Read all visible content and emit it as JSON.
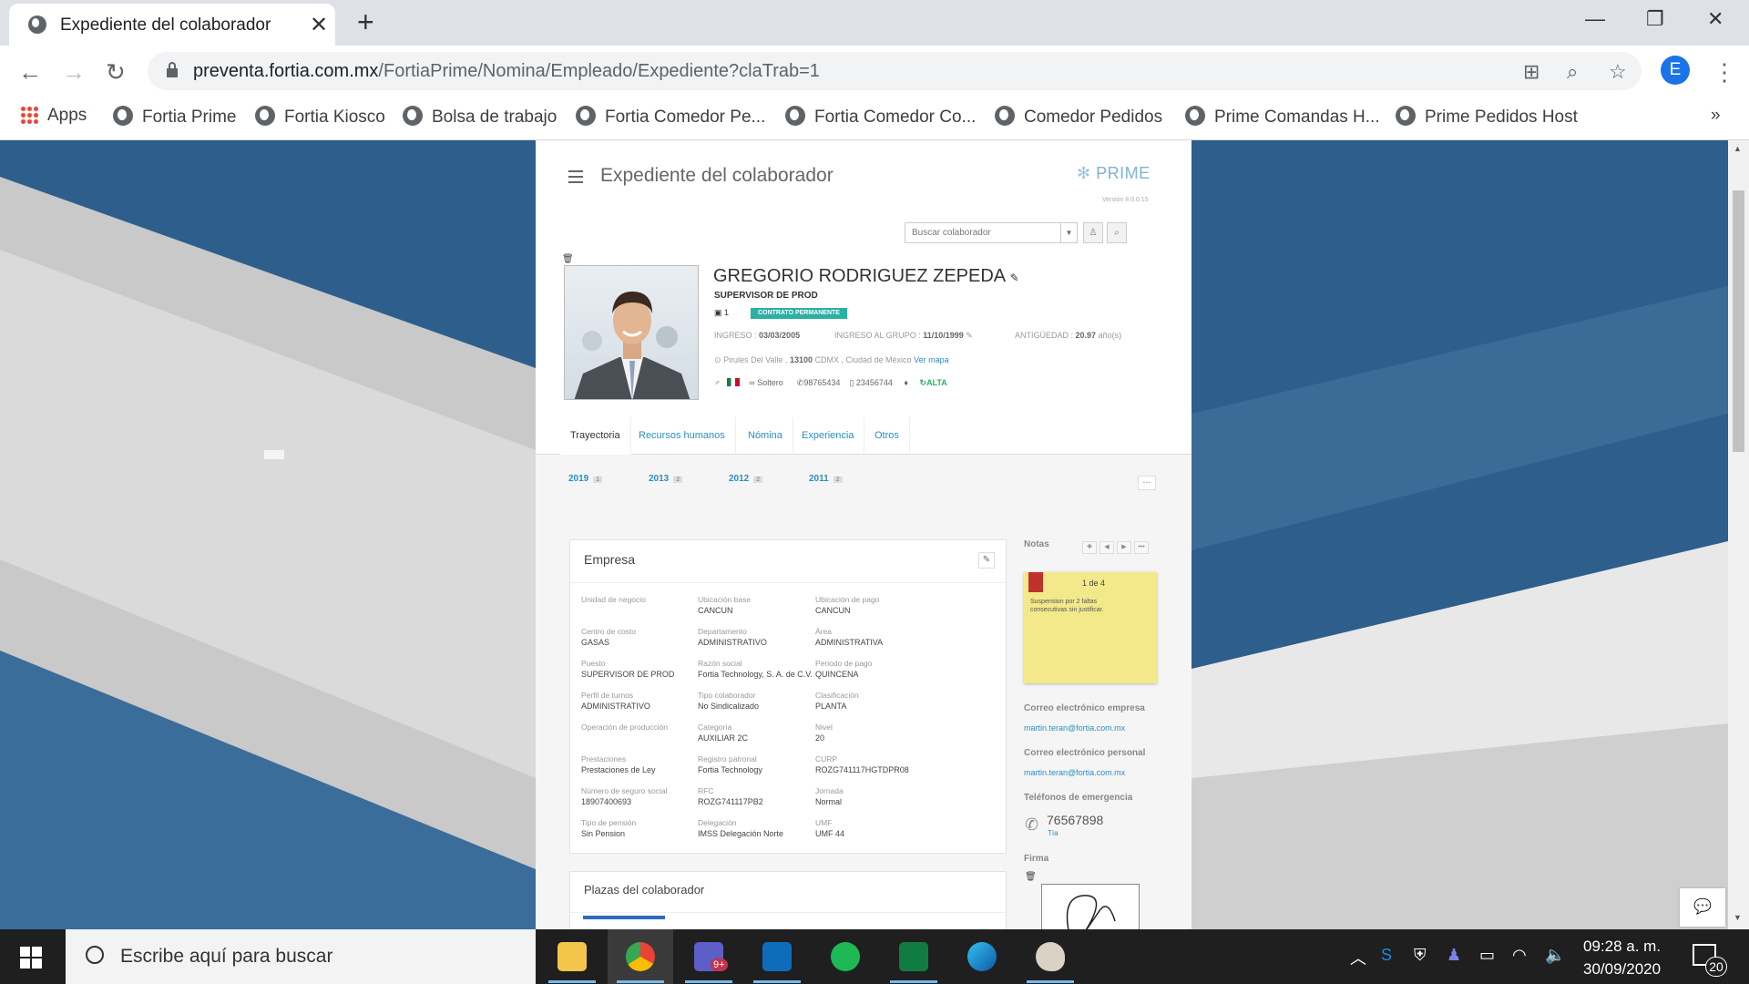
{
  "browser": {
    "tab_title": "Expediente del colaborador",
    "url_host": "preventa.fortia.com.mx",
    "url_path": "/FortiaPrime/Nomina/Empleado/Expediente?claTrab=1",
    "profile_initial": "E",
    "bookmarks": [
      "Apps",
      "Fortia Prime",
      "Fortia Kiosco",
      "Bolsa de trabajo",
      "Fortia Comedor Pe...",
      "Fortia Comedor Co...",
      "Comedor Pedidos",
      "Prime Comandas H...",
      "Prime Pedidos Host"
    ]
  },
  "page": {
    "title": "Expediente del colaborador",
    "logo": "PRIME",
    "version": "Versión 8.0.0.15",
    "search_placeholder": "Buscar colaborador"
  },
  "employee": {
    "name": "GREGORIO RODRIGUEZ ZEPEDA",
    "role": "SUPERVISOR DE PROD",
    "id": "1",
    "contract": "CONTRATO PERMANENTE",
    "ingreso_label": "INGRESO :",
    "ingreso": "03/03/2005",
    "ingreso_grupo_label": "INGRESO AL GRUPO :",
    "ingreso_grupo": "11/10/1999",
    "antiguedad_label": "ANTIGÜEDAD :",
    "antiguedad": "20.97",
    "antiguedad_unit": "año(s)",
    "address": "Pirules Del Valle ,",
    "zip": "13100",
    "address_rest": "CDMX , Ciudad de México",
    "map_link": "Ver mapa",
    "marital": "Soltero",
    "phone": "98765434",
    "mobile": "23456744",
    "status": "ALTA"
  },
  "tabs": [
    "Trayectoria",
    "Recursos humanos",
    "Nómina",
    "Experiencia",
    "Otros"
  ],
  "years": [
    {
      "year": "2019",
      "count": "1"
    },
    {
      "year": "2013",
      "count": "2"
    },
    {
      "year": "2012",
      "count": "2"
    },
    {
      "year": "2011",
      "count": "2"
    }
  ],
  "empresa": {
    "title": "Empresa",
    "fields": [
      {
        "label": "Unidad de negocio",
        "value": ""
      },
      {
        "label": "Ubicación base",
        "value": "CANCUN"
      },
      {
        "label": "Ubicación de pago",
        "value": "CANCUN"
      },
      {
        "label": "Centro de costo",
        "value": "GASAS"
      },
      {
        "label": "Departamento",
        "value": "ADMINISTRATIVO"
      },
      {
        "label": "Área",
        "value": "ADMINISTRATIVA"
      },
      {
        "label": "Puesto",
        "value": "SUPERVISOR DE PROD"
      },
      {
        "label": "Razón social",
        "value": "Fortia Technology, S. A. de C.V."
      },
      {
        "label": "Periodo de pago",
        "value": "QUINCENA"
      },
      {
        "label": "Perfil de turnos",
        "value": "ADMINISTRATIVO"
      },
      {
        "label": "Tipo colaborador",
        "value": "No Sindicalizado"
      },
      {
        "label": "Clasificación",
        "value": "PLANTA"
      },
      {
        "label": "Operación de producción",
        "value": ""
      },
      {
        "label": "Categoría",
        "value": "AUXILIAR 2C"
      },
      {
        "label": "Nivel",
        "value": "20"
      },
      {
        "label": "Prestaciones",
        "value": "Prestaciones de Ley"
      },
      {
        "label": "Registro patronal",
        "value": "Fortia Technology"
      },
      {
        "label": "CURP",
        "value": "ROZG741117HGTDPR08"
      },
      {
        "label": "Número de seguro social",
        "value": "18907400693"
      },
      {
        "label": "RFC",
        "value": "ROZG741117PB2"
      },
      {
        "label": "Jornada",
        "value": "Normal"
      },
      {
        "label": "Tipo de pensión",
        "value": "Sin Pension"
      },
      {
        "label": "Delegación",
        "value": "IMSS Delegación Norte"
      },
      {
        "label": "UMF",
        "value": "UMF 44"
      }
    ]
  },
  "plazas": {
    "title": "Plazas del colaborador"
  },
  "notas": {
    "title": "Notas",
    "counter": "1 de 4",
    "text": "Suspension por 2 faltas consecutivas sin justificar."
  },
  "contact": {
    "email_company_label": "Correo electrónico empresa",
    "email_company": "martin.teran@fortia.com.mx",
    "email_personal_label": "Correo electrónico personal",
    "email_personal": "martin.teran@fortia.com.mx",
    "emergency_label": "Teléfonos de emergencia",
    "emergency_phone": "76567898",
    "emergency_relation": "Tía",
    "signature_label": "Firma"
  },
  "taskbar": {
    "search_placeholder": "Escribe aquí para buscar",
    "time": "09:28 a. m.",
    "date": "30/09/2020",
    "notifications": "20",
    "teams_badge": "9+"
  },
  "colors": {
    "accent": "#2a8fbf",
    "badge": "#2ab0a4",
    "background": "#2d5e8c",
    "note": "#f4e98a"
  }
}
